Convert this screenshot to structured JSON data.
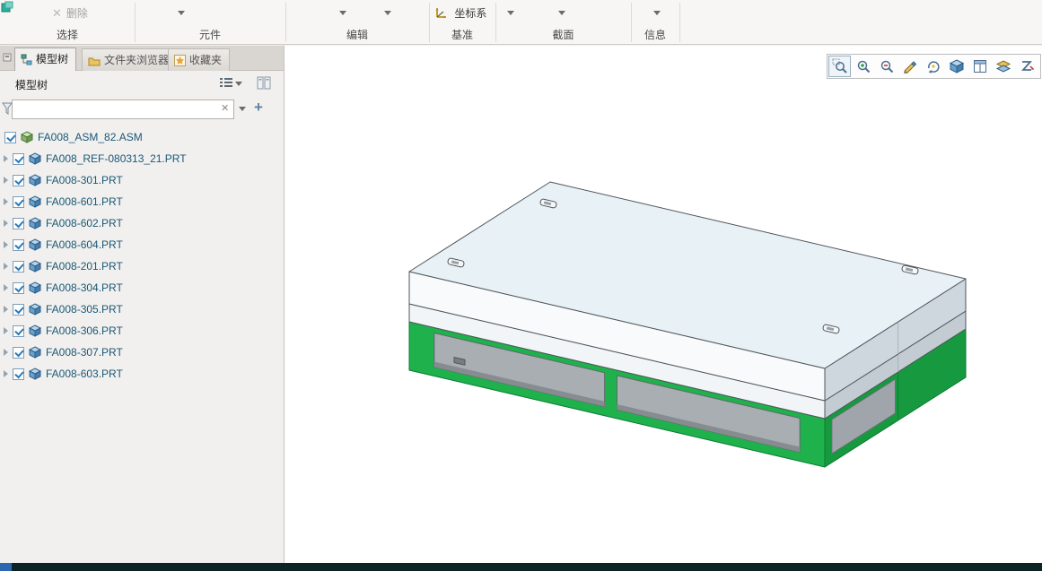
{
  "ribbon": {
    "delete_label": "删除",
    "coord_label": "坐标系",
    "groups": [
      "选择",
      "元件",
      "编辑",
      "基准",
      "截面",
      "信息"
    ]
  },
  "panel": {
    "tabs": [
      "模型树",
      "文件夹浏览器",
      "收藏夹"
    ],
    "tree_title": "模型树",
    "search": {
      "value": "",
      "placeholder": ""
    },
    "tree": {
      "root": "FA008_ASM_82.ASM",
      "items": [
        "FA008_REF-080313_21.PRT",
        "FA008-301.PRT",
        "FA008-601.PRT",
        "FA008-602.PRT",
        "FA008-604.PRT",
        "FA008-201.PRT",
        "FA008-304.PRT",
        "FA008-305.PRT",
        "FA008-306.PRT",
        "FA008-307.PRT",
        "FA008-603.PRT"
      ]
    }
  },
  "viewport": {
    "toolbar_icons": [
      "zoom-window",
      "zoom-in",
      "zoom-out",
      "repaint",
      "reorient",
      "saved-views",
      "view-manager",
      "layers",
      "zone-clip"
    ]
  },
  "icons": {
    "close": "✕",
    "plus": "+"
  },
  "colors": {
    "plate_top": "#e8f1f6",
    "plate_front": "#f8fafb",
    "plate_right": "#cdd7dd",
    "base_front_green": "#1fb14c",
    "base_right_green": "#17993f",
    "insert_gray": "#a9aeb3",
    "tree_text": "#1a5876",
    "check_blue": "#2b7ab8"
  }
}
